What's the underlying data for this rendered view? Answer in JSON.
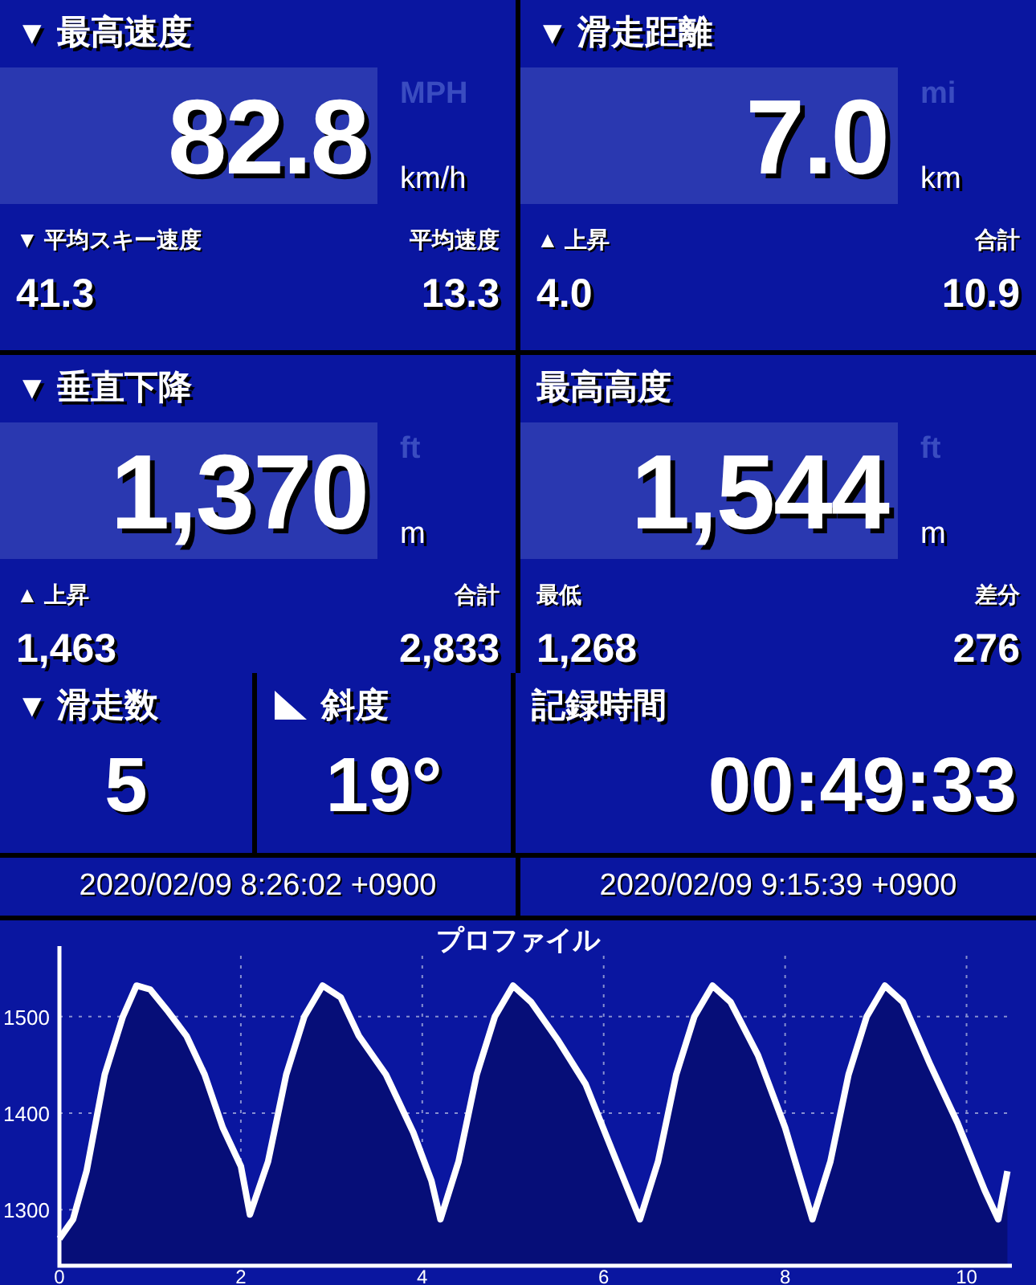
{
  "panels_top": [
    {
      "marker": "▼",
      "title": "最高速度",
      "value": "82.8",
      "units": [
        {
          "label": "MPH",
          "selected": false
        },
        {
          "label": "km/h",
          "selected": true
        }
      ],
      "stats": [
        {
          "label": "▼ 平均スキー速度",
          "value": "41.3"
        },
        {
          "label": "平均速度",
          "value": "13.3"
        }
      ]
    },
    {
      "marker": "▼",
      "title": "滑走距離",
      "value": "7.0",
      "units": [
        {
          "label": "mi",
          "selected": false
        },
        {
          "label": "km",
          "selected": true
        }
      ],
      "stats": [
        {
          "label": "▲ 上昇",
          "value": "4.0"
        },
        {
          "label": "合計",
          "value": "10.9"
        }
      ]
    },
    {
      "marker": "▼",
      "title": "垂直下降",
      "value": "1,370",
      "units": [
        {
          "label": "ft",
          "selected": false
        },
        {
          "label": "m",
          "selected": true
        }
      ],
      "stats": [
        {
          "label": "▲ 上昇",
          "value": "1,463"
        },
        {
          "label": "合計",
          "value": "2,833"
        }
      ]
    },
    {
      "title": "最高高度",
      "value": "1,544",
      "units": [
        {
          "label": "ft",
          "selected": false
        },
        {
          "label": "m",
          "selected": true
        }
      ],
      "stats": [
        {
          "label": "最低",
          "value": "1,268"
        },
        {
          "label": "差分",
          "value": "276"
        }
      ]
    }
  ],
  "panels_small": [
    {
      "kind": "count",
      "marker": "▼",
      "title": "滑走数",
      "value": "5"
    },
    {
      "kind": "slope",
      "title": "斜度",
      "value": "19°"
    },
    {
      "kind": "time",
      "title": "記録時間",
      "value": "00:49:33"
    }
  ],
  "timestamps": [
    "2020/02/09 8:26:02 +0900",
    "2020/02/09 9:15:39 +0900"
  ],
  "profile": {
    "title": "プロファイル",
    "chart_data": {
      "type": "area",
      "x": [
        0,
        0.15,
        0.3,
        0.5,
        0.7,
        0.85,
        1.0,
        1.2,
        1.4,
        1.6,
        1.8,
        2.0,
        2.1,
        2.3,
        2.5,
        2.7,
        2.9,
        3.1,
        3.3,
        3.6,
        3.9,
        4.1,
        4.2,
        4.4,
        4.6,
        4.8,
        5.0,
        5.2,
        5.5,
        5.8,
        6.1,
        6.4,
        6.6,
        6.8,
        7.0,
        7.2,
        7.4,
        7.7,
        8.0,
        8.3,
        8.5,
        8.7,
        8.9,
        9.1,
        9.3,
        9.6,
        9.9,
        10.2,
        10.35,
        10.45
      ],
      "series": [
        {
          "color": "#ffffff",
          "values": [
            1270,
            1290,
            1340,
            1440,
            1500,
            1532,
            1528,
            1505,
            1480,
            1440,
            1385,
            1345,
            1295,
            1350,
            1440,
            1500,
            1532,
            1520,
            1480,
            1440,
            1380,
            1330,
            1290,
            1350,
            1440,
            1500,
            1532,
            1515,
            1475,
            1430,
            1360,
            1290,
            1350,
            1440,
            1500,
            1532,
            1515,
            1460,
            1385,
            1290,
            1350,
            1440,
            1500,
            1532,
            1515,
            1450,
            1390,
            1320,
            1290,
            1340
          ]
        }
      ],
      "grid": true,
      "xlim": [
        0,
        10.5
      ],
      "ylim": [
        1242,
        1563
      ],
      "xticks": [
        0,
        2,
        4,
        6,
        8,
        10
      ],
      "yticks": [
        1300,
        1400,
        1500
      ]
    }
  }
}
